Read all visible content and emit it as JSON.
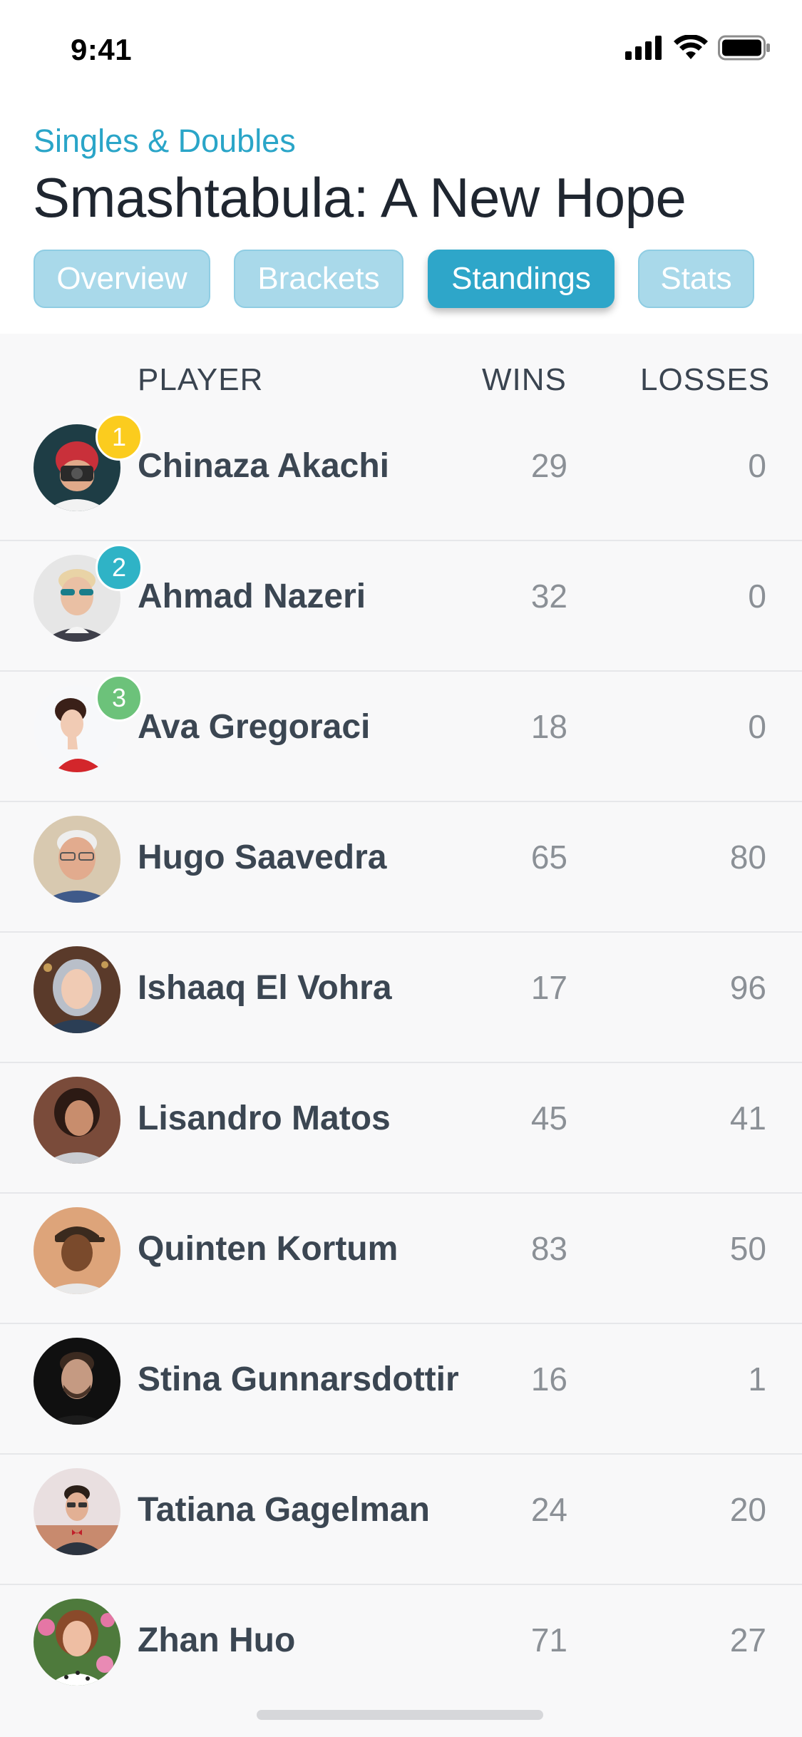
{
  "status_bar": {
    "time": "9:41"
  },
  "header": {
    "subtitle": "Singles & Doubles",
    "title": "Smashtabula: A New Hope"
  },
  "tabs": [
    {
      "label": "Overview",
      "active": false
    },
    {
      "label": "Brackets",
      "active": false
    },
    {
      "label": "Standings",
      "active": true
    },
    {
      "label": "Stats",
      "active": false
    }
  ],
  "table": {
    "columns": {
      "player": "PLAYER",
      "wins": "WINS",
      "losses": "LOSSES"
    },
    "rows": [
      {
        "rank": "1",
        "rank_color": "#fbcc1e",
        "name": "Chinaza Akachi",
        "wins": "29",
        "losses": "0"
      },
      {
        "rank": "2",
        "rank_color": "#2fb3c6",
        "name": "Ahmad Nazeri",
        "wins": "32",
        "losses": "0"
      },
      {
        "rank": "3",
        "rank_color": "#6cc27a",
        "name": "Ava Gregoraci",
        "wins": "18",
        "losses": "0"
      },
      {
        "rank": "",
        "name": "Hugo Saavedra",
        "wins": "65",
        "losses": "80"
      },
      {
        "rank": "",
        "name": "Ishaaq El Vohra",
        "wins": "17",
        "losses": "96"
      },
      {
        "rank": "",
        "name": "Lisandro Matos",
        "wins": "45",
        "losses": "41"
      },
      {
        "rank": "",
        "name": "Quinten Kortum",
        "wins": "83",
        "losses": "50"
      },
      {
        "rank": "",
        "name": "Stina Gunnarsdottir",
        "wins": "16",
        "losses": "1"
      },
      {
        "rank": "",
        "name": "Tatiana Gagelman",
        "wins": "24",
        "losses": "20"
      },
      {
        "rank": "",
        "name": "Zhan Huo",
        "wins": "71",
        "losses": "27"
      }
    ]
  },
  "colors": {
    "accent": "#2ea6c9",
    "tab_inactive": "#a9d9ea",
    "title": "#1f2630"
  }
}
